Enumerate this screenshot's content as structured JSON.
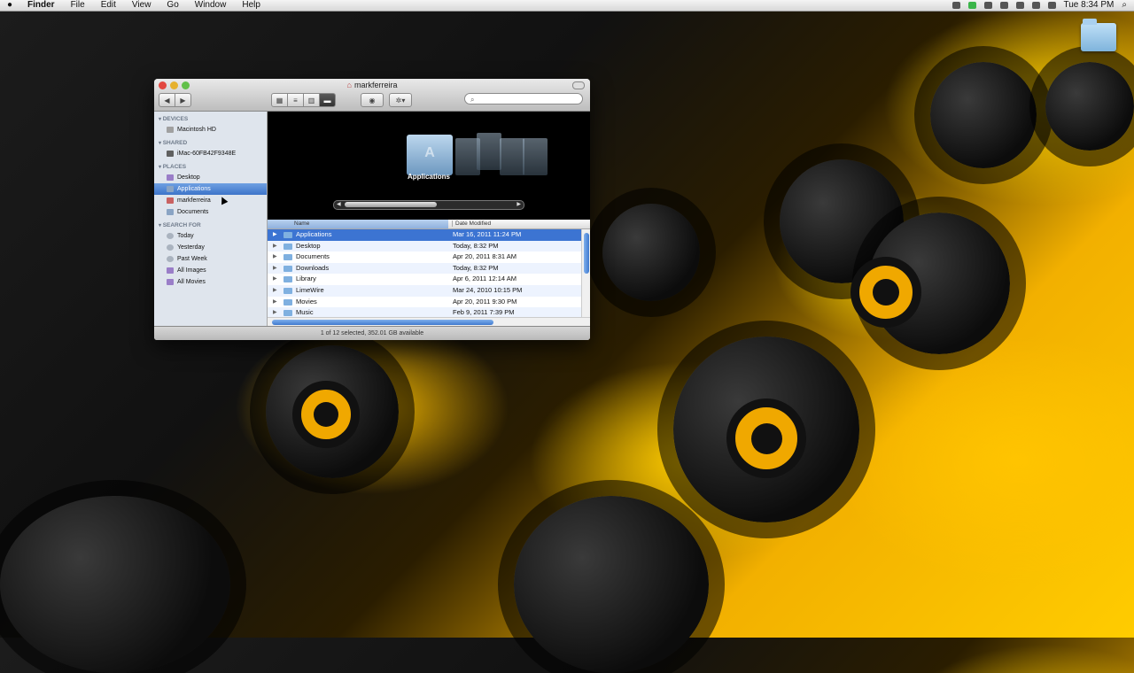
{
  "menubar": {
    "app_name": "Finder",
    "menus": [
      "File",
      "Edit",
      "View",
      "Go",
      "Window",
      "Help"
    ],
    "clock": "Tue 8:34 PM"
  },
  "window": {
    "title": "markferreira",
    "search_placeholder": "",
    "status": "1 of 12 selected, 352.01 GB available"
  },
  "sidebar": {
    "devices_label": "DEVICES",
    "devices": [
      "Macintosh HD"
    ],
    "shared_label": "SHARED",
    "shared": [
      "iMac-60FB42F9348E"
    ],
    "places_label": "PLACES",
    "places": [
      "Desktop",
      "Applications",
      "markferreira",
      "Documents"
    ],
    "search_label": "SEARCH FOR",
    "search_items": [
      "Today",
      "Yesterday",
      "Past Week",
      "All Images",
      "All Movies"
    ]
  },
  "coverflow": {
    "current_label": "Applications"
  },
  "list": {
    "col_name": "Name",
    "col_date": "Date Modified",
    "rows": [
      {
        "name": "Applications",
        "date": "Mar 16, 2011 11:24 PM"
      },
      {
        "name": "Desktop",
        "date": "Today, 8:32 PM"
      },
      {
        "name": "Documents",
        "date": "Apr 20, 2011 8:31 AM"
      },
      {
        "name": "Downloads",
        "date": "Today, 8:32 PM"
      },
      {
        "name": "Library",
        "date": "Apr 6, 2011 12:14 AM"
      },
      {
        "name": "LimeWire",
        "date": "Mar 24, 2010 10:15 PM"
      },
      {
        "name": "Movies",
        "date": "Apr 20, 2011 9:30 PM"
      },
      {
        "name": "Music",
        "date": "Feb 9, 2011 7:39 PM"
      }
    ]
  }
}
